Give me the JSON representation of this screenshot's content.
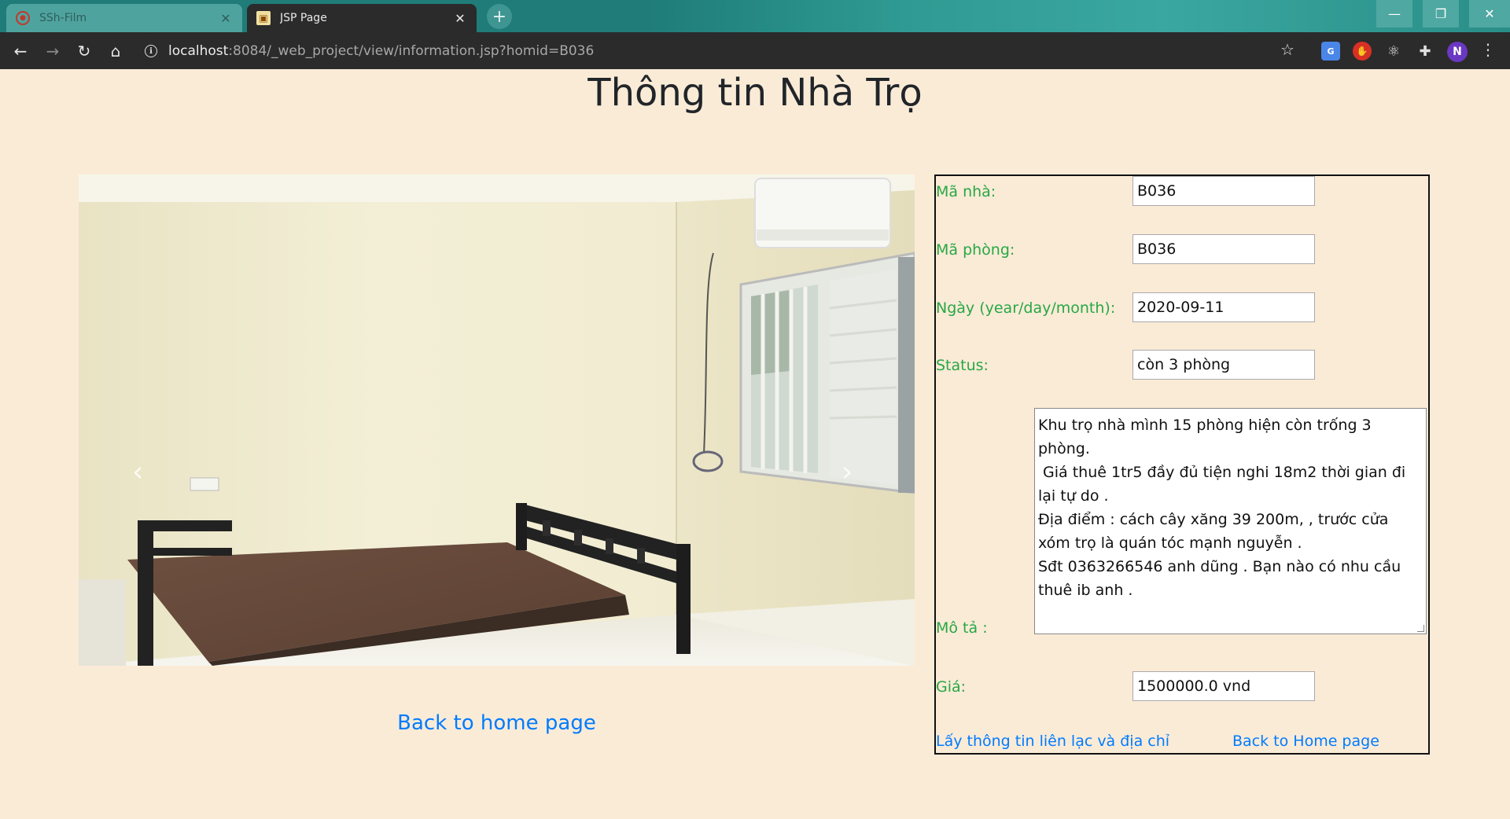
{
  "browser": {
    "tabs": [
      {
        "title": "SSh-Film",
        "active": false
      },
      {
        "title": "JSP Page",
        "active": true
      }
    ],
    "url_host": "localhost",
    "url_rest": ":8084/_web_project/view/information.jsp?homid=B036",
    "profile_initial": "N",
    "translate_ext": "G"
  },
  "page": {
    "title": "Thông tin Nhà Trọ",
    "back_link": "Back to home page"
  },
  "info": {
    "ma_nha_label": "Mã nhà:",
    "ma_nha_value": "B036",
    "ma_phong_label": "Mã phòng:",
    "ma_phong_value": "B036",
    "ngay_label": "Ngày (year/day/month):",
    "ngay_value": "2020-09-11",
    "status_label": "Status:",
    "status_value": "còn 3 phòng",
    "mo_ta_label": "Mô tả :",
    "mo_ta_value": "Khu trọ nhà mình 15 phòng hiện còn trống 3 phòng.\n Giá thuê 1tr5 đầy đủ tiện nghi 18m2 thời gian đi lại tự do .\nĐịa điểm : cách cây xăng 39 200m, , trước cửa xóm trọ là quán tóc mạnh nguyễn .\nSđt 0363266546 anh dũng . Bạn nào có nhu cầu thuê ib anh .",
    "gia_label": "Giá:",
    "gia_value": "1500000.0 vnd",
    "contact_link": "Lấy thông tin liên lạc và địa chỉ",
    "home_link": "Back to Home page"
  },
  "colors": {
    "page_bg": "#faebd7",
    "label_green": "#28a745",
    "link_blue": "#007bff",
    "tabbar_teal": "#1f7c78"
  },
  "icons": [
    "back-arrow-icon",
    "forward-arrow-icon",
    "reload-icon",
    "home-icon",
    "info-icon",
    "star-icon",
    "puzzle-icon",
    "menu-dots-icon",
    "chevron-left-icon",
    "chevron-right-icon"
  ]
}
